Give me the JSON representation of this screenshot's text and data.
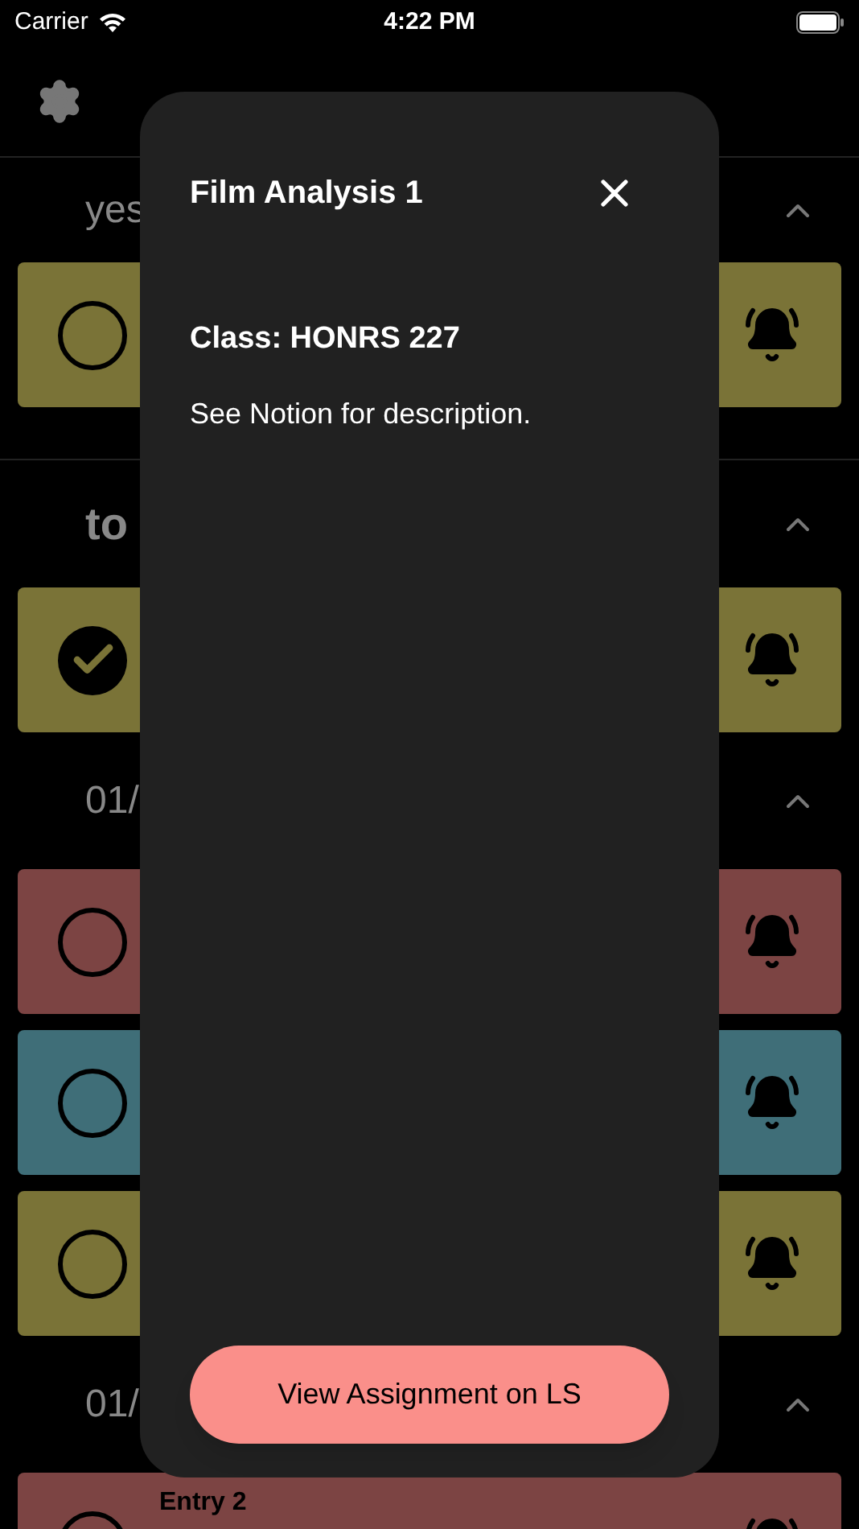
{
  "status_bar": {
    "carrier": "Carrier",
    "time": "4:22 PM"
  },
  "sections": [
    {
      "label": "yes",
      "kind": "date",
      "divider": true,
      "cards": [
        {
          "color": "#7a7337",
          "done": false
        }
      ]
    },
    {
      "label": "to",
      "kind": "current",
      "divider": false,
      "cards": [
        {
          "color": "#7a7337",
          "done": true
        }
      ]
    },
    {
      "label": "01/",
      "kind": "date",
      "divider": false,
      "cards": [
        {
          "color": "#7c4443",
          "done": false
        },
        {
          "color": "#3f6e78",
          "done": false
        },
        {
          "color": "#7a7337",
          "done": false
        }
      ]
    },
    {
      "label": "01/",
      "kind": "date",
      "divider": false,
      "cards": [
        {
          "color": "#7c4443",
          "done": false,
          "title": "Entry 2"
        }
      ]
    }
  ],
  "modal": {
    "title": "Film Analysis 1",
    "class_line": "Class: HONRS 227",
    "description": "See Notion for description.",
    "button": "View Assignment on LS"
  }
}
